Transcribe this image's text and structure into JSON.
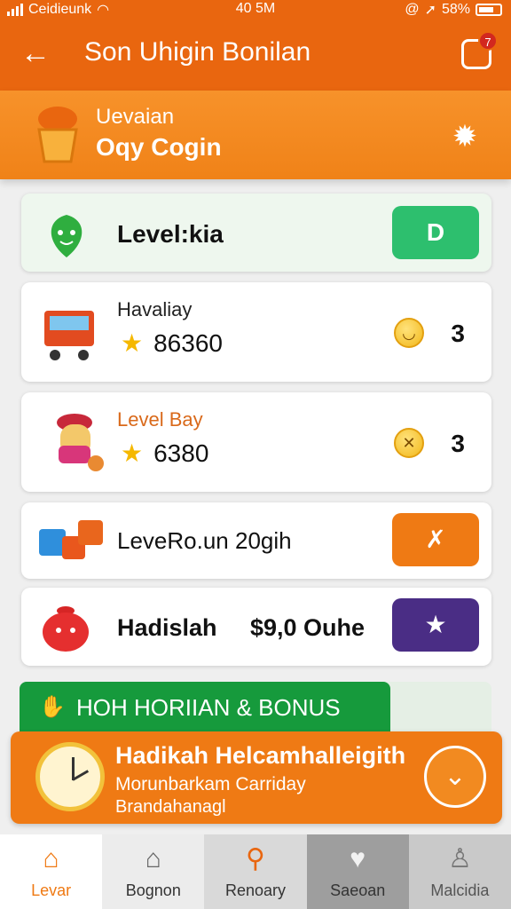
{
  "status_bar": {
    "carrier": "Ceidieunk",
    "time": "40 5M",
    "battery": "58%",
    "icons": [
      "signal-icon",
      "wifi-icon",
      "alarm-icon",
      "location-icon",
      "battery-icon"
    ]
  },
  "app_bar": {
    "title": "Son Uhigin Bonilan",
    "back_icon": "arrow-left-icon",
    "notification_count": "7"
  },
  "subheader": {
    "line1": "Uevaian",
    "line2": "Oqy Cogin"
  },
  "cards": [
    {
      "title": "Level:kia",
      "action_label": "D",
      "action_color": "#2dbf6e"
    },
    {
      "subtitle": "Havaliay",
      "value": "86360",
      "count": "3"
    },
    {
      "subtitle": "Level Bay",
      "value": "6380",
      "count": "3"
    },
    {
      "title": "LeveRo.un 20gih",
      "action_icon": "wrench-icon",
      "action_color": "#ef7a14"
    },
    {
      "title": "Hadislah",
      "amount": "$9,0 Ouhe",
      "action_icon": "star-icon",
      "action_color": "#4a2d85"
    }
  ],
  "bonus_banner": {
    "label": "HOH HORIIAN & BONUS"
  },
  "promo": {
    "title": "Hadikah Helcamhalleigith",
    "line2": "Morunbarkam Carriday",
    "line3": "Brandahanagl"
  },
  "bottom_nav": [
    {
      "label": "Levar",
      "icon": "home-icon",
      "active": true
    },
    {
      "label": "Bognon",
      "icon": "shop-icon"
    },
    {
      "label": "Renoary",
      "icon": "search-icon"
    },
    {
      "label": "Saeoan",
      "icon": "heart-icon"
    },
    {
      "label": "Malcidia",
      "icon": "profile-icon"
    }
  ],
  "colors": {
    "primary": "#e9660f",
    "accent_orange": "#ef7a14",
    "green": "#169a3c",
    "purple": "#4a2d85"
  }
}
